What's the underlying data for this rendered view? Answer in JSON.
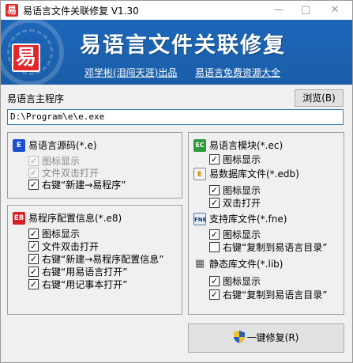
{
  "window": {
    "title": "易语言文件关联修复 V1.30",
    "app_icon": "易",
    "minimize_icon": "—",
    "maximize_icon": "□",
    "close_icon": "✕"
  },
  "banner": {
    "logo_glyph": "易",
    "title": "易语言文件关联修复",
    "author_link": "邓学彬(泪闯天涯)出品",
    "resources_link": "易语言免费资源大全",
    "background_color": "#1d66b8"
  },
  "main_program": {
    "label": "易语言主程序",
    "browse_label": "浏览(B)",
    "path_value": "D:\\Program\\e\\e.exe"
  },
  "groups": {
    "source": {
      "title": "易语言源码(*.e)",
      "icon": "E",
      "options": [
        {
          "label": "图标显示",
          "checked": true,
          "disabled": true
        },
        {
          "label": "文件双击打开",
          "checked": true,
          "disabled": true
        },
        {
          "label": "右键“新建→易程序”",
          "checked": true,
          "disabled": false
        }
      ]
    },
    "config": {
      "title": "易程序配置信息(*.e8)",
      "icon": "E8",
      "options": [
        {
          "label": "图标显示",
          "checked": true
        },
        {
          "label": "文件双击打开",
          "checked": true
        },
        {
          "label": "右键“新建→易程序配置信息”",
          "checked": true
        },
        {
          "label": "右键“用易语言打开”",
          "checked": true
        },
        {
          "label": "右键“用记事本打开”",
          "checked": true
        }
      ]
    },
    "module": {
      "title": "易语言模块(*.ec)",
      "icon": "EC",
      "options": [
        {
          "label": "图标显示",
          "checked": true
        }
      ]
    },
    "database": {
      "title": "易数据库文件(*.edb)",
      "icon": "E",
      "options": [
        {
          "label": "图标显示",
          "checked": true
        },
        {
          "label": "双击打开",
          "checked": true
        }
      ]
    },
    "support": {
      "title": "支持库文件(*.fne)",
      "icon": "FNE",
      "options": [
        {
          "label": "图标显示",
          "checked": true
        },
        {
          "label": "右键“复制到易语言目录”",
          "checked": false
        }
      ]
    },
    "static": {
      "title": "静态库文件(*.lib)",
      "icon": "▦",
      "options": [
        {
          "label": "图标显示",
          "checked": true
        },
        {
          "label": "右键“复制到易语言目录”",
          "checked": true
        }
      ]
    }
  },
  "repair_label": "一键修复(R)",
  "check_mark": "✓"
}
